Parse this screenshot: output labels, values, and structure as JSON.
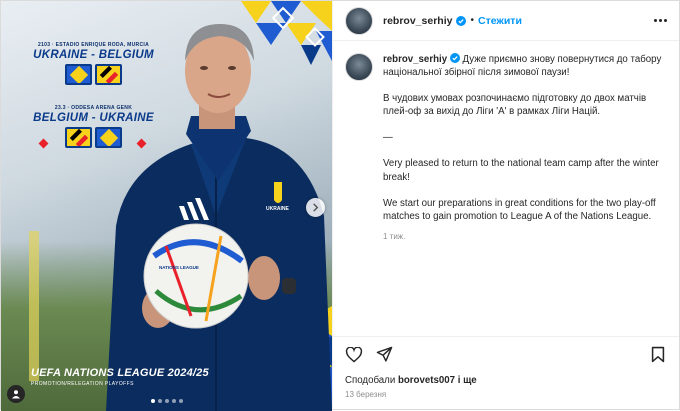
{
  "post": {
    "username": "rebrov_serhiy",
    "follow_label": "Стежити",
    "separator": "•",
    "caption_username": "rebrov_serhiy",
    "caption_line1": "Дуже приємно знову повернутися до табору національної збірної після зимової паузи!",
    "caption_line2": "В чудових умовах розпочинаємо підготовку до двох матчів плей-оф за вихід до Ліги 'А' в рамках Ліги Націй.",
    "caption_divider": "—",
    "caption_line3": "Very pleased to return to the national team camp after the winter break!",
    "caption_line4": "We start our preparations in great conditions for the two play-off matches to gain promotion to League A of the Nations League.",
    "time_ago": "1 тиж.",
    "likes_prefix": "Сподобали",
    "likes_user": "borovets007",
    "likes_suffix": "і ще",
    "date": "13 березня"
  },
  "media": {
    "match1_meta": "2103 · ESTADIO ENRIQUE RODA, MURCIA",
    "match1_title": "UKRAINE - BELGIUM",
    "match2_meta": "23.3 · ODDESA ARENA GENK",
    "match2_title": "BELGIUM - UKRAINE",
    "footer_title": "UEFA NATIONS LEAGUE 2024/25",
    "footer_sub": "PROMOTION/RELEGATION PLAYOFFS",
    "jersey_text": "UKRAINE",
    "ball_text": "NATIONS LEAGUE",
    "carousel_total": 5,
    "carousel_active": 1
  },
  "colors": {
    "link_blue": "#0095f6",
    "ukraine_blue": "#1f5bd1",
    "ukraine_yellow": "#f7d21c",
    "navy": "#0a3a8a",
    "text": "#262626",
    "muted": "#8e8e8e"
  },
  "icons": {
    "like": "heart-icon",
    "share": "send-icon",
    "save": "bookmark-icon",
    "more": "more-icon",
    "verified": "verified-badge-icon",
    "next": "chevron-right-icon"
  }
}
